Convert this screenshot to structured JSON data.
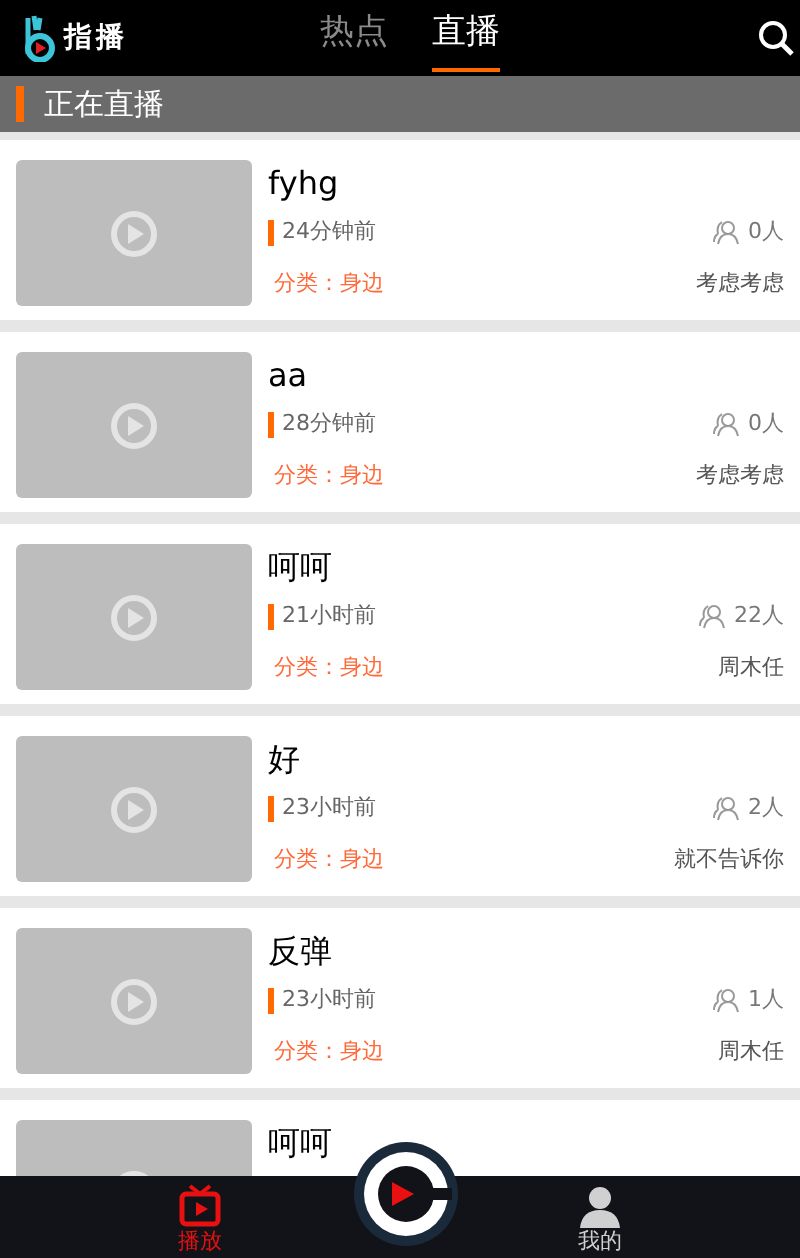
{
  "app": {
    "name": "指播"
  },
  "tabs": [
    {
      "label": "热点",
      "selected": false
    },
    {
      "label": "直播",
      "selected": true
    }
  ],
  "section": {
    "title": "正在直播"
  },
  "streams": [
    {
      "title": "fyhg",
      "time": "24分钟前",
      "viewers": "0人",
      "category": "分类：身边",
      "author": "考虑考虑"
    },
    {
      "title": "aa",
      "time": "28分钟前",
      "viewers": "0人",
      "category": "分类：身边",
      "author": "考虑考虑"
    },
    {
      "title": "呵呵",
      "time": "21小时前",
      "viewers": "22人",
      "category": "分类：身边",
      "author": "周木任"
    },
    {
      "title": "好",
      "time": "23小时前",
      "viewers": "2人",
      "category": "分类：身边",
      "author": "就不告诉你"
    },
    {
      "title": "反弹",
      "time": "23小时前",
      "viewers": "1人",
      "category": "分类：身边",
      "author": "周木任"
    },
    {
      "title": "呵呵"
    }
  ],
  "bottom_nav": [
    {
      "label": "播放",
      "kind": "tv",
      "selected": true
    },
    {
      "label": "我的",
      "kind": "person",
      "selected": false
    }
  ]
}
